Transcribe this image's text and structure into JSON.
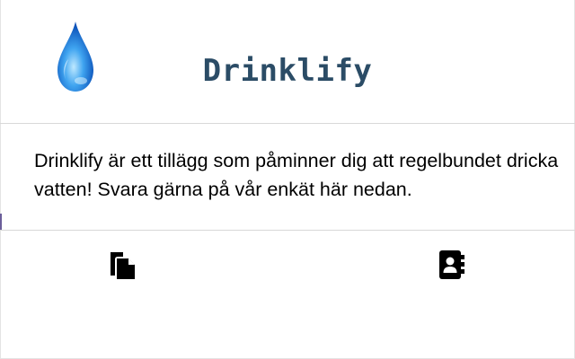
{
  "header": {
    "title": "Drinklify",
    "logo_icon": "water-drop-icon"
  },
  "main": {
    "description": "Drinklify är ett tillägg som påminner dig att regelbundet dricka vatten! Svara gärna på vår enkät här nedan."
  },
  "footer": {
    "survey_icon": "copy-document-icon",
    "contact_icon": "contact-book-icon"
  },
  "colors": {
    "title": "#2b4c66",
    "drop_light": "#8fd3ff",
    "drop_dark": "#0a5cc7",
    "icon": "#000000",
    "divider": "#d8d8d8"
  }
}
